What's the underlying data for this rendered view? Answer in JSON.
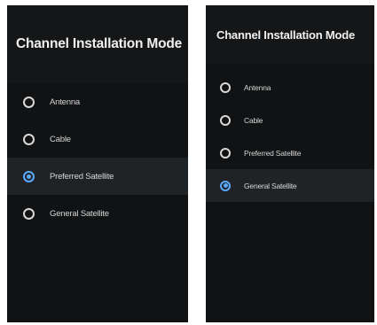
{
  "colors": {
    "panel_background": "#101214",
    "header_background": "#141618",
    "selected_row": "#202326",
    "radio_selected": "#5aa9ff",
    "text": "#d6d6d6"
  },
  "left_screen": {
    "title": "Channel Installation Mode",
    "options": [
      {
        "label": "Antenna",
        "selected": false
      },
      {
        "label": "Cable",
        "selected": false
      },
      {
        "label": "Preferred Satellite",
        "selected": true
      },
      {
        "label": "General Satellite",
        "selected": false
      }
    ]
  },
  "right_screen": {
    "title": "Channel Installation Mode",
    "options": [
      {
        "label": "Antenna",
        "selected": false
      },
      {
        "label": "Cable",
        "selected": false
      },
      {
        "label": "Preferred Satellite",
        "selected": false
      },
      {
        "label": "General Satellite",
        "selected": true
      }
    ]
  }
}
